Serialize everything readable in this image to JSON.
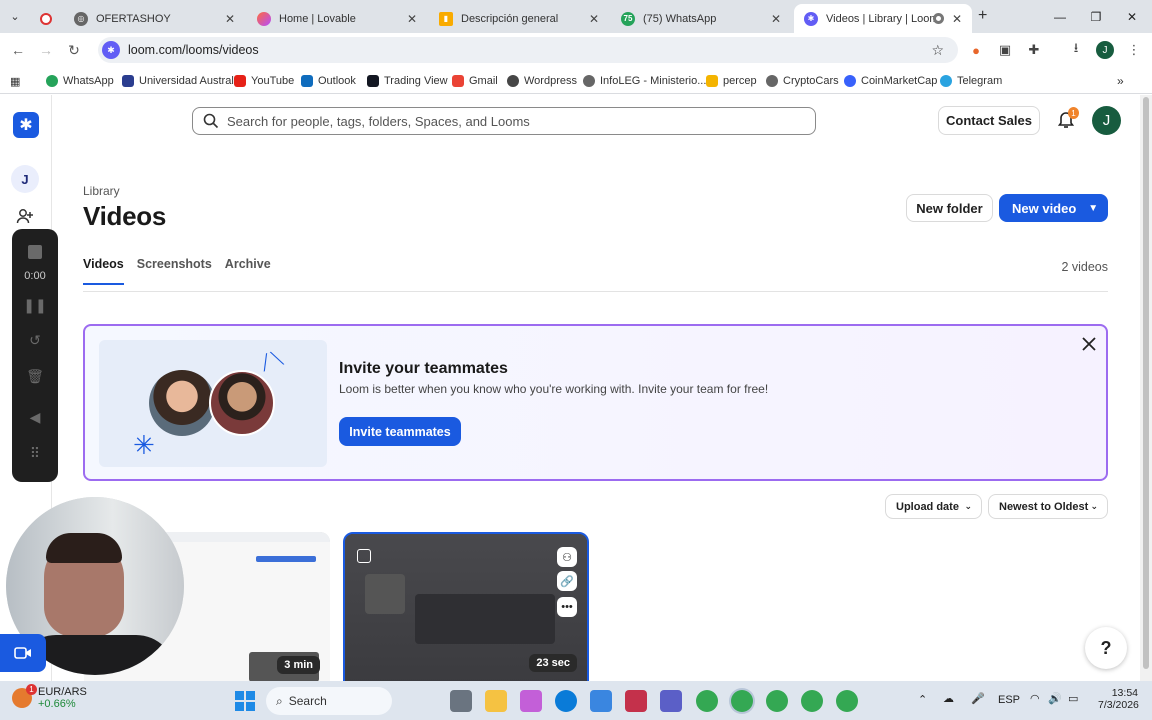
{
  "browser": {
    "tabs": [
      {
        "label": "OFERTASHOY",
        "icon": "web-icon"
      },
      {
        "label": "Home | Lovable",
        "icon": "lovable-icon"
      },
      {
        "label": "Descripción general",
        "icon": "analytics-icon"
      },
      {
        "label": "(75) WhatsApp",
        "icon": "whatsapp-icon",
        "badge": "75"
      },
      {
        "label": "Videos | Library | Loom",
        "icon": "loom-icon",
        "active": true
      }
    ],
    "url": "loom.com/looms/videos",
    "profile_initial": "J",
    "bookmarks": [
      "WhatsApp",
      "Universidad Austral",
      "YouTube",
      "Outlook",
      "Trading View",
      "Gmail",
      "Wordpress",
      "InfoLEG - Ministerio...",
      "percep",
      "CryptoCars",
      "CoinMarketCap",
      "Telegram"
    ]
  },
  "app": {
    "brand_color": "#1a5ae0",
    "workspace_initial": "J",
    "search_placeholder": "Search for people, tags, folders, Spaces, and Looms",
    "contact_sales": "Contact Sales",
    "notification_count": "1",
    "user_initial": "J",
    "breadcrumb": "Library",
    "title": "Videos",
    "new_folder": "New folder",
    "new_video": "New video",
    "tabs": [
      "Videos",
      "Screenshots",
      "Archive"
    ],
    "video_count": "2 videos",
    "invite": {
      "title": "Invite your teammates",
      "subtitle": "Loom is better when you know who you're working with. Invite your team for free!",
      "button": "Invite teammates"
    },
    "sort": {
      "field": "Upload date",
      "order": "Newest to Oldest"
    },
    "videos": [
      {
        "duration": "3 min"
      },
      {
        "duration": "23 sec"
      }
    ],
    "help": "?"
  },
  "recorder": {
    "time": "0:00"
  },
  "taskbar": {
    "ticker": "EUR/ARS",
    "ticker_change": "+0.66%",
    "ticker_badge": "1",
    "search": "Search",
    "language": "ESP",
    "time": "13:54",
    "date": "7/3/2026"
  }
}
